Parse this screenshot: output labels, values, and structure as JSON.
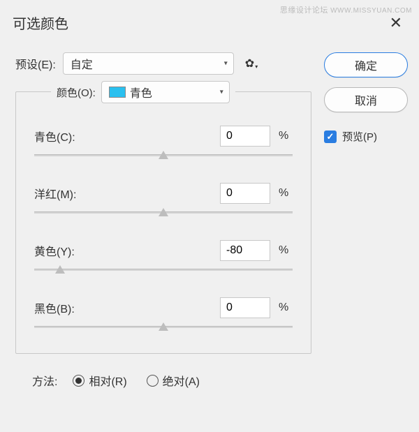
{
  "watermark": {
    "cn": "思缘设计论坛",
    "en": "WWW.MISSYUAN.COM"
  },
  "dialog": {
    "title": "可选颜色",
    "preset_label": "预设(E):",
    "preset_value": "自定",
    "color_label": "颜色(O):",
    "color_value": "青色",
    "color_swatch_hex": "#2ac0ef",
    "sliders": {
      "cyan": {
        "label": "青色(C):",
        "value": "0",
        "thumb_pct": 50
      },
      "magenta": {
        "label": "洋红(M):",
        "value": "0",
        "thumb_pct": 50
      },
      "yellow": {
        "label": "黄色(Y):",
        "value": "-80",
        "thumb_pct": 10
      },
      "black": {
        "label": "黑色(B):",
        "value": "0",
        "thumb_pct": 50
      }
    },
    "percent_sign": "%",
    "method": {
      "label": "方法:",
      "relative": "相对(R)",
      "absolute": "绝对(A)",
      "selected": "relative"
    }
  },
  "buttons": {
    "ok": "确定",
    "cancel": "取消",
    "preview": "预览(P)"
  }
}
